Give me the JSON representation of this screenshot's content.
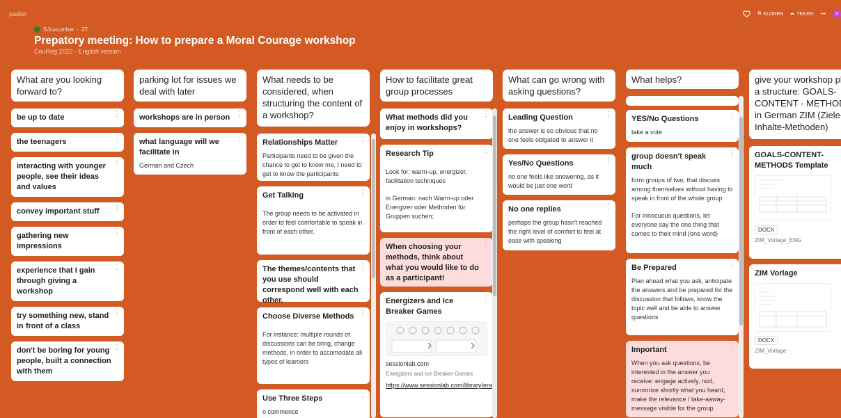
{
  "app": {
    "brand": "padlet"
  },
  "header": {
    "author": "SJcucumber",
    "age": "3T",
    "title": "Prepatory meeting: How to prepare a Moral Courage workshop",
    "subtitle": "CouReg 2022 - English version",
    "actions": {
      "clone": "KLONEN",
      "share": "TEILEN",
      "more": "•••",
      "avatar": "Y"
    }
  },
  "columns": [
    {
      "title": "What are you looking forward to?",
      "cards": [
        {
          "title": "be up to date"
        },
        {
          "title": "the teenagers"
        },
        {
          "title": "interacting with younger people, see their ideas and values"
        },
        {
          "title": "convey important stuff"
        },
        {
          "title": "gathering new impressions"
        },
        {
          "title": "experience that I gain through giving a workshop"
        },
        {
          "title": "try something new, stand in front of a class"
        },
        {
          "title": "don't be boring for young people, built a connection with them"
        }
      ]
    },
    {
      "title": "parking lot for issues we deal with later",
      "cards": [
        {
          "title": "workshops are in person"
        },
        {
          "title": "what language will we facilitate in",
          "text": "German and Czech"
        }
      ]
    },
    {
      "title": "What needs to be considered, when structuring the content of a workshop?",
      "cards": [
        {
          "title": "Relationships Matter",
          "text": "Participants need to be given the chance to get to know me, I need to get to know the participants"
        },
        {
          "title": "Get Talking",
          "text": "The group needs to be activated in order to feel comfortable to speak in front of each other."
        },
        {
          "title": "The themes/contents that you use should correspond well with each other."
        },
        {
          "title": "Choose Diverse Methods",
          "text": "For instance: multiple rounds of discussions can be tiring, change methods, in order to accomodate all types of learners"
        },
        {
          "title": "Use Three Steps",
          "text": "o   commence"
        }
      ]
    },
    {
      "title": "How to facilitate great group processes",
      "cards": [
        {
          "title": "What methods did you enjoy in workshops?"
        },
        {
          "title": "Research Tip",
          "text": "Look for: warm-up, energizer, facilitation techniques",
          "text2": "in German: nach Warm-up oder Energizer oder Methoden für Gruppen suchen;"
        },
        {
          "title": "When choosing your methods, think about what you would like to do as a participant!"
        },
        {
          "title": "Energizers and Ice Breaker Games",
          "domain": "sessionlab.com",
          "caption": "Energizers and Ice Breaker Games",
          "link": "https://www.sessionlab.com/library/energiser"
        }
      ]
    },
    {
      "title": "What can go wrong with asking questions?",
      "cards": [
        {
          "title": "Leading Question",
          "text": "the answer is so obvious that no one feels oblgated to answer it"
        },
        {
          "title": "Yes/No Questions",
          "text": "no one feels like answering, as it would be just one word"
        },
        {
          "title": "No one replies",
          "text": "perhaps the group hasn't reached the right level of comfort to feel at ease with speaking"
        }
      ]
    },
    {
      "title": "What helps?",
      "cards": [
        {
          "title": "YES/No Questions",
          "text": "take a vote"
        },
        {
          "title": "group doesn't speak much",
          "text": "form groups of two, that discuss among themselves without having to speak in front of the whole group",
          "text2": "For innocuous questions, let everyone say the one thing that comes to their mind (one word)"
        },
        {
          "title": "Be Prepared",
          "text": "Plan ahead what you ask, anticipate the answers and be prepared for the discussion that follows, know the topic well and be able to answer questions"
        },
        {
          "title": "Important",
          "text": "When you ask questions, be interested in the answer you receive: engage actively, nod, summrize shortly what you heard, make the relevance / take-aaway-message visible for the group."
        }
      ]
    },
    {
      "title": "give your workshop plan a structure: GOALS-CONTENT - METHODS in German ZIM (Ziele-Inhalte-Methoden)",
      "cards": [
        {
          "title": "GOALS-CONTENT-METHODS Template",
          "badge": "DOCX",
          "file": "ZIM_Vorlage_ENG"
        },
        {
          "title": "ZIM Vorlage",
          "badge": "DOCX",
          "file": "ZIM_Vorlage"
        }
      ]
    }
  ]
}
